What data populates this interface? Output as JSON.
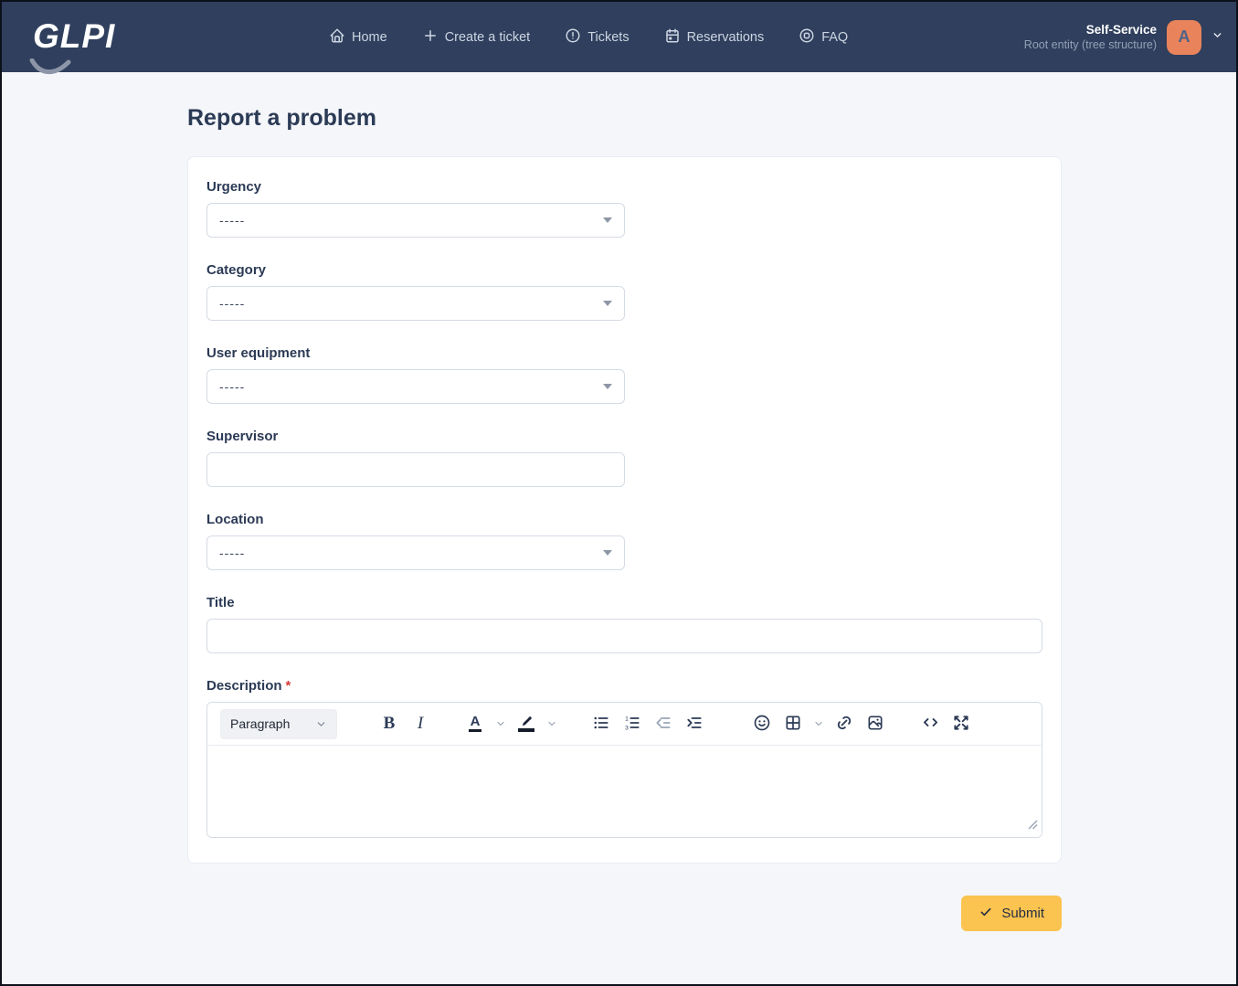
{
  "navbar": {
    "logo_text": "GLPI",
    "items": [
      {
        "label": "Home",
        "icon": "home-icon"
      },
      {
        "label": "Create a ticket",
        "icon": "plus-icon"
      },
      {
        "label": "Tickets",
        "icon": "alert-circle-icon"
      },
      {
        "label": "Reservations",
        "icon": "calendar-icon"
      },
      {
        "label": "FAQ",
        "icon": "help-icon"
      }
    ],
    "user": {
      "profile": "Self-Service",
      "entity": "Root entity (tree structure)",
      "avatar_letter": "A"
    }
  },
  "page": {
    "title": "Report a problem"
  },
  "form": {
    "fields": [
      {
        "label": "Urgency",
        "type": "select",
        "value": "-----"
      },
      {
        "label": "Category",
        "type": "select",
        "value": "-----"
      },
      {
        "label": "User equipment",
        "type": "select",
        "value": "-----"
      },
      {
        "label": "Supervisor",
        "type": "text",
        "value": ""
      },
      {
        "label": "Location",
        "type": "select",
        "value": "-----"
      },
      {
        "label": "Title",
        "type": "text",
        "value": ""
      },
      {
        "label": "Description",
        "type": "richtext",
        "value": "",
        "required_mark": "*"
      }
    ]
  },
  "editor": {
    "paragraph_label": "Paragraph",
    "bold_glyph": "B",
    "italic_glyph": "I",
    "text_color_glyph": "A",
    "buttons": [
      "paragraph-format",
      "bold",
      "italic",
      "text-color",
      "highlight-color",
      "bullet-list",
      "numbered-list",
      "outdent",
      "indent",
      "emoji",
      "table",
      "link",
      "image",
      "source-code",
      "fullscreen"
    ]
  },
  "submit": {
    "label": "Submit"
  },
  "colors": {
    "navbar_bg": "#2f3f5d",
    "page_bg": "#f4f6fa",
    "submit_bg": "#fbc34f",
    "avatar_bg": "#e8835c",
    "required_red": "#d63939",
    "label_text": "#2b3a55"
  }
}
